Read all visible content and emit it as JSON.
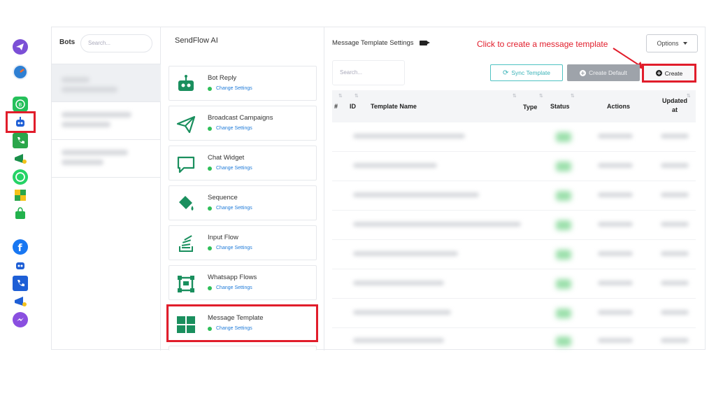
{
  "annotation": {
    "text": "Click to create a message template",
    "color": "#e11d2b"
  },
  "bots": {
    "title": "Bots",
    "search_placeholder": "Search..."
  },
  "features": {
    "title": "SendFlow AI",
    "items": [
      {
        "name": "Bot Reply",
        "sub": "Change Settings",
        "icon": "robot-icon"
      },
      {
        "name": "Broadcast Campaigns",
        "sub": "Change Settings",
        "icon": "paper-plane-icon"
      },
      {
        "name": "Chat Widget",
        "sub": "Change Settings",
        "icon": "chat-bubble-icon"
      },
      {
        "name": "Sequence",
        "sub": "Change Settings",
        "icon": "paint-bucket-icon"
      },
      {
        "name": "Input Flow",
        "sub": "Change Settings",
        "icon": "stack-icon"
      },
      {
        "name": "Whatsapp Flows",
        "sub": "Change Settings",
        "icon": "flow-frame-icon"
      },
      {
        "name": "Message Template",
        "sub": "Change Settings",
        "icon": "grid-icon"
      }
    ]
  },
  "panel": {
    "title": "Message Template Settings",
    "options_label": "Options",
    "search_placeholder": "Search...",
    "sync_label": "Sync Template",
    "default_label": "Create Default",
    "create_label": "Create",
    "columns": {
      "num": "#",
      "id": "ID",
      "name": "Template Name",
      "type": "Type",
      "status": "Status",
      "actions": "Actions",
      "updated": "Updated at"
    }
  },
  "colors": {
    "accent": "#1f7bd9",
    "teal": "#3ab3b8",
    "brand_green": "#1a8f5e",
    "highlight": "#e11d2b"
  }
}
